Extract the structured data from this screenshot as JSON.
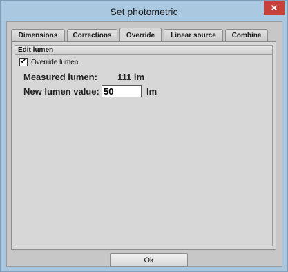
{
  "window": {
    "title": "Set photometric",
    "close_glyph": "✕"
  },
  "tabs": [
    {
      "label": "Dimensions"
    },
    {
      "label": "Corrections"
    },
    {
      "label": "Override",
      "active": true
    },
    {
      "label": "Linear source"
    },
    {
      "label": "Combine"
    }
  ],
  "edit_lumen": {
    "header": "Edit lumen",
    "override_checkbox": {
      "label": "Override lumen",
      "checked": true,
      "check_glyph": "✔"
    },
    "measured_label": "Measured lumen:",
    "measured_value": "111 lm",
    "new_label": "New lumen value:",
    "new_value": "50",
    "unit": "lm"
  },
  "footer": {
    "ok_label": "Ok"
  },
  "colors": {
    "title_bar": "#abc8e1",
    "close_button": "#c7403a",
    "dialog_bg": "#c7c7c7"
  }
}
